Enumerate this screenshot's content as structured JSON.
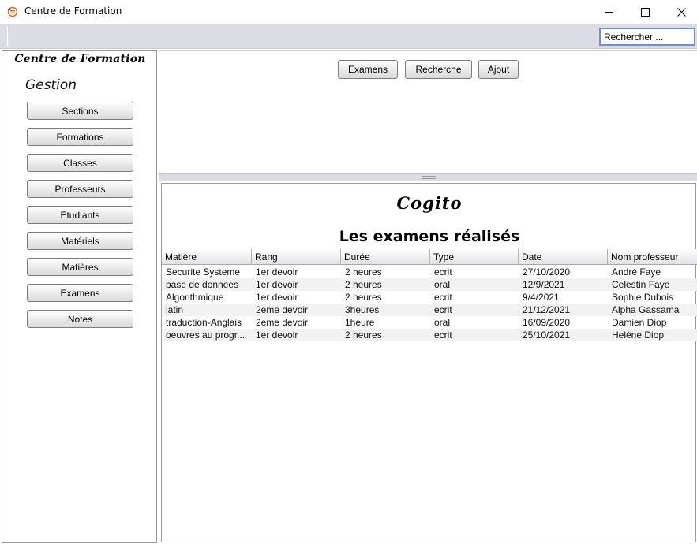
{
  "window": {
    "title": "Centre de Formation"
  },
  "toolbar": {
    "search_value": "Rechercher ..."
  },
  "sidebar": {
    "brand": "Centre de Formation",
    "section_title": "Gestion",
    "items": [
      {
        "label": "Sections"
      },
      {
        "label": "Formations"
      },
      {
        "label": "Classes"
      },
      {
        "label": "Professeurs"
      },
      {
        "label": "Etudiants"
      },
      {
        "label": "Matériels"
      },
      {
        "label": "Matières"
      },
      {
        "label": "Examens"
      },
      {
        "label": "Notes"
      }
    ]
  },
  "actions": {
    "examens": "Examens",
    "recherche": "Recherche",
    "ajout": "Ajout"
  },
  "content": {
    "logo": "Cogito",
    "title": "Les examens réalisés",
    "columns": [
      "Matière",
      "Rang",
      "Durée",
      "Type",
      "Date",
      "Nom professeur"
    ],
    "rows": [
      [
        "Securite Systeme",
        "1er devoir",
        "2 heures",
        "ecrit",
        "27/10/2020",
        "André Faye"
      ],
      [
        "base de donnees",
        "1er devoir",
        "2 heures",
        "oral",
        "12/9/2021",
        "Celestin Faye"
      ],
      [
        "Algorithmique",
        "1er devoir",
        "2 heures",
        "ecrit",
        "9/4/2021",
        "Sophie Dubois"
      ],
      [
        "latin",
        "2eme devoir",
        "3heures",
        "ecrit",
        "21/12/2021",
        "Alpha Gassama"
      ],
      [
        "traduction-Anglais",
        "2eme devoir",
        "1heure",
        "oral",
        "16/09/2020",
        "Damien Diop"
      ],
      [
        "oeuvres au progr...",
        "1er devoir",
        "2 heures",
        "ecrit",
        "25/10/2021",
        "Helène Diop"
      ]
    ]
  },
  "colors": {
    "accent": "#e8601c",
    "toolbar_bg": "#dcdde4",
    "search_border": "#6f8fc6"
  }
}
